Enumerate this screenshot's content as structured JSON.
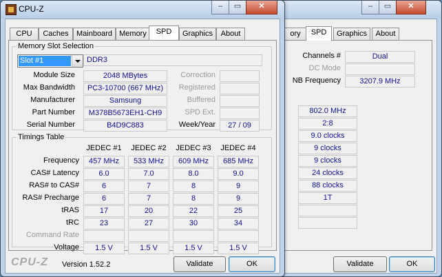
{
  "app": {
    "title": "CPU-Z"
  },
  "window_controls": {
    "minimize": "–",
    "maximize": "▭",
    "close": "✕"
  },
  "tabs": [
    "CPU",
    "Caches",
    "Mainboard",
    "Memory",
    "SPD",
    "Graphics",
    "About"
  ],
  "memory_slot": {
    "group_label": "Memory Slot Selection",
    "slot_selected": "Slot #1",
    "type": "DDR3",
    "rows": [
      {
        "label": "Module Size",
        "value": "2048 MBytes",
        "right_label": "Correction",
        "right_value": ""
      },
      {
        "label": "Max Bandwidth",
        "value": "PC3-10700 (667 MHz)",
        "right_label": "Registered",
        "right_value": ""
      },
      {
        "label": "Manufacturer",
        "value": "Samsung",
        "right_label": "Buffered",
        "right_value": ""
      },
      {
        "label": "Part Number",
        "value": "M378B5673EH1-CH9",
        "right_label": "SPD Ext.",
        "right_value": ""
      },
      {
        "label": "Serial Number",
        "value": "B4D9C883",
        "right_label": "Week/Year",
        "right_value": "27 / 09"
      }
    ]
  },
  "timings": {
    "group_label": "Timings Table",
    "columns": [
      "JEDEC #1",
      "JEDEC #2",
      "JEDEC #3",
      "JEDEC #4"
    ],
    "rows": [
      {
        "label": "Frequency",
        "values": [
          "457 MHz",
          "533 MHz",
          "609 MHz",
          "685 MHz"
        ]
      },
      {
        "label": "CAS# Latency",
        "values": [
          "6.0",
          "7.0",
          "8.0",
          "9.0"
        ]
      },
      {
        "label": "RAS# to CAS#",
        "values": [
          "6",
          "7",
          "8",
          "9"
        ]
      },
      {
        "label": "RAS# Precharge",
        "values": [
          "6",
          "7",
          "8",
          "9"
        ]
      },
      {
        "label": "tRAS",
        "values": [
          "17",
          "20",
          "22",
          "25"
        ]
      },
      {
        "label": "tRC",
        "values": [
          "23",
          "27",
          "30",
          "34"
        ]
      },
      {
        "label": "Command Rate",
        "values": [
          "",
          "",
          "",
          ""
        ]
      },
      {
        "label": "Voltage",
        "values": [
          "1.5 V",
          "1.5 V",
          "1.5 V",
          "1.5 V"
        ]
      }
    ]
  },
  "footer": {
    "brand": "CPU-Z",
    "version": "Version 1.52.2",
    "validate": "Validate",
    "ok": "OK"
  },
  "back_window": {
    "tabs_visible": [
      "ory",
      "SPD",
      "Graphics",
      "About"
    ],
    "general": [
      {
        "label": "Channels #",
        "value": "Dual"
      },
      {
        "label": "DC Mode",
        "value": ""
      },
      {
        "label": "NB Frequency",
        "value": "3207.9 MHz"
      }
    ],
    "timings_values": [
      "802.0 MHz",
      "2:8",
      "9.0 clocks",
      "9 clocks",
      "9 clocks",
      "24 clocks",
      "88 clocks",
      "1T",
      "",
      ""
    ],
    "validate": "Validate",
    "ok": "OK"
  }
}
